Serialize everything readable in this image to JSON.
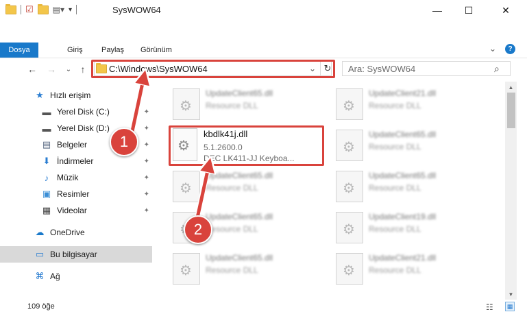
{
  "window": {
    "title": "SysWOW64",
    "minimize": "—",
    "maximize": "☐",
    "close": "✕"
  },
  "ribbon": {
    "tabs": [
      "Dosya",
      "Giriş",
      "Paylaş",
      "Görünüm"
    ],
    "expand": "⌄",
    "help": "?"
  },
  "address": {
    "path": "C:\\Windows\\SysWOW64",
    "dropdown": "⌄",
    "refresh": "↻"
  },
  "search": {
    "placeholder": "Ara: SysWOW64",
    "icon": "⌕"
  },
  "nav": {
    "back": "←",
    "forward": "→",
    "recent": "⌄",
    "up": "↑"
  },
  "sidebar": {
    "items": [
      {
        "label": "Hızlı erişim",
        "icon": "★",
        "pinned": false
      },
      {
        "label": "Yerel Disk (C:)",
        "icon": "▬",
        "pinned": true
      },
      {
        "label": "Yerel Disk (D:)",
        "icon": "▬",
        "pinned": true
      },
      {
        "label": "Belgeler",
        "icon": "▤",
        "pinned": true
      },
      {
        "label": "İndirmeler",
        "icon": "⬇",
        "pinned": true
      },
      {
        "label": "Müzik",
        "icon": "♪",
        "pinned": true
      },
      {
        "label": "Resimler",
        "icon": "▣",
        "pinned": true
      },
      {
        "label": "Videolar",
        "icon": "▦",
        "pinned": true
      },
      {
        "label": "OneDrive",
        "icon": "☁",
        "pinned": false
      },
      {
        "label": "Bu bilgisayar",
        "icon": "▭",
        "pinned": false,
        "selected": true
      },
      {
        "label": "Ağ",
        "icon": "⌘",
        "pinned": false
      }
    ],
    "pin_icon": "📌"
  },
  "files": {
    "highlighted": {
      "name": "kbdlk41j.dll",
      "version": "5.1.2600.0",
      "description": "DEC LK411-JJ Keyboa..."
    },
    "blurred": [
      {
        "name": "UpdateClient65.dll",
        "type": "Resource DLL"
      },
      {
        "name": "UpdateClient21.dll",
        "type": "Resource DLL"
      },
      {
        "name": "UpdateClient65.dll",
        "type": "Resource DLL"
      },
      {
        "name": "UpdateClient65.dll",
        "type": "Resource DLL"
      },
      {
        "name": "UpdateClient65.dll",
        "type": "Resource DLL"
      },
      {
        "name": "UpdateClient65.dll",
        "type": "Resource DLL"
      },
      {
        "name": "UpdateClient19.dll",
        "type": "Resource DLL"
      },
      {
        "name": "UpdateClient65.dll",
        "type": "Resource DLL"
      },
      {
        "name": "UpdateClient21.dll",
        "type": "Resource DLL"
      }
    ]
  },
  "status": {
    "count": "109 öğe"
  },
  "callouts": {
    "one": "1",
    "two": "2"
  },
  "colors": {
    "accent": "#1979ca",
    "highlight": "#d9433c"
  }
}
